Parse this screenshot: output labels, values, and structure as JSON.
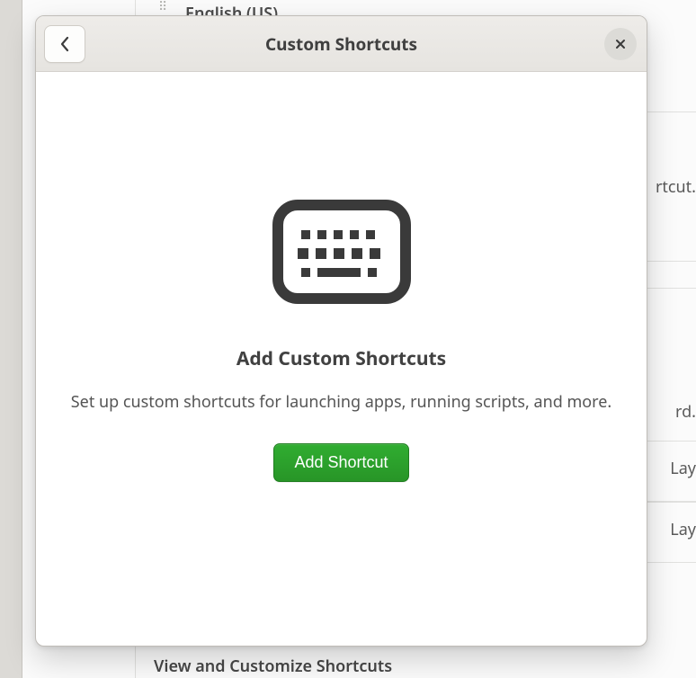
{
  "background": {
    "input_source": "English (US)",
    "right_fragments": {
      "line1": "rtcut.",
      "line2": "rd.",
      "line3": "Lay",
      "line4": "Lay"
    },
    "section_title": "View and Customize Shortcuts"
  },
  "modal": {
    "title": "Custom Shortcuts",
    "heading": "Add Custom Shortcuts",
    "description": "Set up custom shortcuts for launching apps, running scripts, and more.",
    "add_button": "Add Shortcut"
  }
}
